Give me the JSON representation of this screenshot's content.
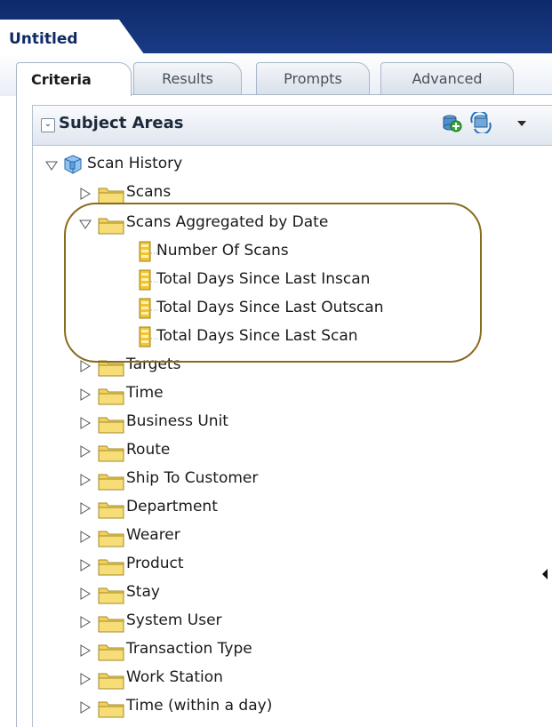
{
  "document_tab": {
    "title": "Untitled"
  },
  "tabs": [
    {
      "label": "Criteria",
      "active": true
    },
    {
      "label": "Results",
      "active": false
    },
    {
      "label": "Prompts",
      "active": false
    },
    {
      "label": "Advanced",
      "active": false
    }
  ],
  "panel": {
    "title": "Subject Areas",
    "collapse_glyph": "⌄",
    "icons": [
      "add-subject-area-icon",
      "refresh-icon",
      "dropdown-arrow-icon"
    ]
  },
  "tree": {
    "root": {
      "label": "Scan History",
      "expanded": true,
      "icon": "cube-icon"
    },
    "folders": [
      {
        "label": "Scans",
        "expanded": false
      },
      {
        "label": "Scans Aggregated by Date",
        "expanded": true,
        "children": [
          "Number Of Scans",
          "Total Days Since Last Inscan",
          "Total Days Since Last Outscan",
          "Total Days Since Last Scan"
        ]
      },
      {
        "label": "Targets",
        "expanded": false
      },
      {
        "label": "Time",
        "expanded": false
      },
      {
        "label": "Business Unit",
        "expanded": false
      },
      {
        "label": "Route",
        "expanded": false
      },
      {
        "label": "Ship To Customer",
        "expanded": false
      },
      {
        "label": "Department",
        "expanded": false
      },
      {
        "label": "Wearer",
        "expanded": false
      },
      {
        "label": "Product",
        "expanded": false
      },
      {
        "label": "Stay",
        "expanded": false
      },
      {
        "label": "System User",
        "expanded": false
      },
      {
        "label": "Transaction Type",
        "expanded": false
      },
      {
        "label": "Work Station",
        "expanded": false
      },
      {
        "label": "Time (within a day)",
        "expanded": false
      }
    ]
  },
  "colors": {
    "banner": "#0e2a6b",
    "folder": "#f2d25a",
    "highlight_outline": "#8a6a1f"
  }
}
